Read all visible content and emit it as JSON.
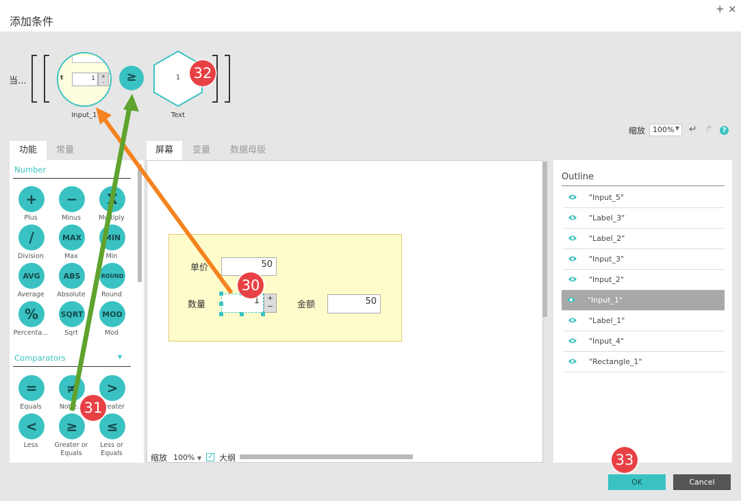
{
  "dialog": {
    "title": "添加条件",
    "add_glyph": "+",
    "close_glyph": "×"
  },
  "condition": {
    "prefix": "当...",
    "left_node": {
      "label": "Input_1",
      "value": "1",
      "spin_plus": "+",
      "spin_minus": "-",
      "cut_letter": "t"
    },
    "operator_symbol": "≥",
    "right_node": {
      "label": "Text",
      "value": "1"
    }
  },
  "zoom_top": {
    "label": "缩放",
    "value": "100%"
  },
  "left_panel": {
    "tabs": [
      "功能",
      "常量"
    ],
    "sections": [
      {
        "title": "Number"
      },
      {
        "title": "Comparators"
      }
    ],
    "number_functions": [
      {
        "icon": "plus-icon",
        "glyph": "+",
        "label": "Plus"
      },
      {
        "icon": "minus-icon",
        "glyph": "−",
        "label": "Minus"
      },
      {
        "icon": "multiply-icon",
        "glyph": "X",
        "label": "Multiply"
      },
      {
        "icon": "division-icon",
        "glyph": "/",
        "label": "Division"
      },
      {
        "icon": "max-icon",
        "glyph": "MAX",
        "label": "Max"
      },
      {
        "icon": "min-icon",
        "glyph": "MIN",
        "label": "Min"
      },
      {
        "icon": "avg-icon",
        "glyph": "AVG",
        "label": "Average"
      },
      {
        "icon": "abs-icon",
        "glyph": "ABS",
        "label": "Absolute"
      },
      {
        "icon": "round-icon",
        "glyph": "ROUND",
        "label": "Round"
      },
      {
        "icon": "percent-icon",
        "glyph": "%",
        "label": "Percenta..."
      },
      {
        "icon": "sqrt-icon",
        "glyph": "SQRT",
        "label": "Sqrt"
      },
      {
        "icon": "mod-icon",
        "glyph": "MOD",
        "label": "Mod"
      }
    ],
    "comparators": [
      {
        "icon": "equals-icon",
        "glyph": "=",
        "label": "Equals"
      },
      {
        "icon": "not-equals-icon",
        "glyph": "≠",
        "label": "Not e..."
      },
      {
        "icon": "greater-icon",
        "glyph": ">",
        "label": "...reater"
      },
      {
        "icon": "less-icon",
        "glyph": "<",
        "label": "Less"
      },
      {
        "icon": "greater-equals-icon",
        "glyph": "≥",
        "label": "Greater or Equals"
      },
      {
        "icon": "less-equals-icon",
        "glyph": "≤",
        "label": "Less or Equals"
      }
    ]
  },
  "mid_tabs": [
    "屏幕",
    "变量",
    "数据母版"
  ],
  "canvas": {
    "price_label": "单价",
    "price_value": "50",
    "qty_label": "数量",
    "qty_value": "1",
    "spin_plus": "+",
    "spin_minus": "−",
    "amount_label": "金额",
    "amount_value": "50"
  },
  "outline": {
    "title": "Outline",
    "items": [
      "\"Input_5\"",
      "\"Label_3\"",
      "\"Label_2\"",
      "\"Input_3\"",
      "\"Input_2\"",
      "\"Input_1\"",
      "\"Label_1\"",
      "\"Input_4\"",
      "\"Rectangle_1\""
    ],
    "selected_index": 5
  },
  "bottom": {
    "zoom_label": "缩放",
    "zoom_value": "100%",
    "outline_label": "大纲",
    "outline_checked": true
  },
  "buttons": {
    "ok": "OK",
    "cancel": "Cancel"
  },
  "annotations": {
    "b30": "30",
    "b31": "31",
    "b32": "32",
    "b33": "33"
  },
  "colors": {
    "accent": "#3ac2c2",
    "badge": "#e84145",
    "arrow_orange": "#f5831f",
    "arrow_green": "#5fa32e"
  }
}
